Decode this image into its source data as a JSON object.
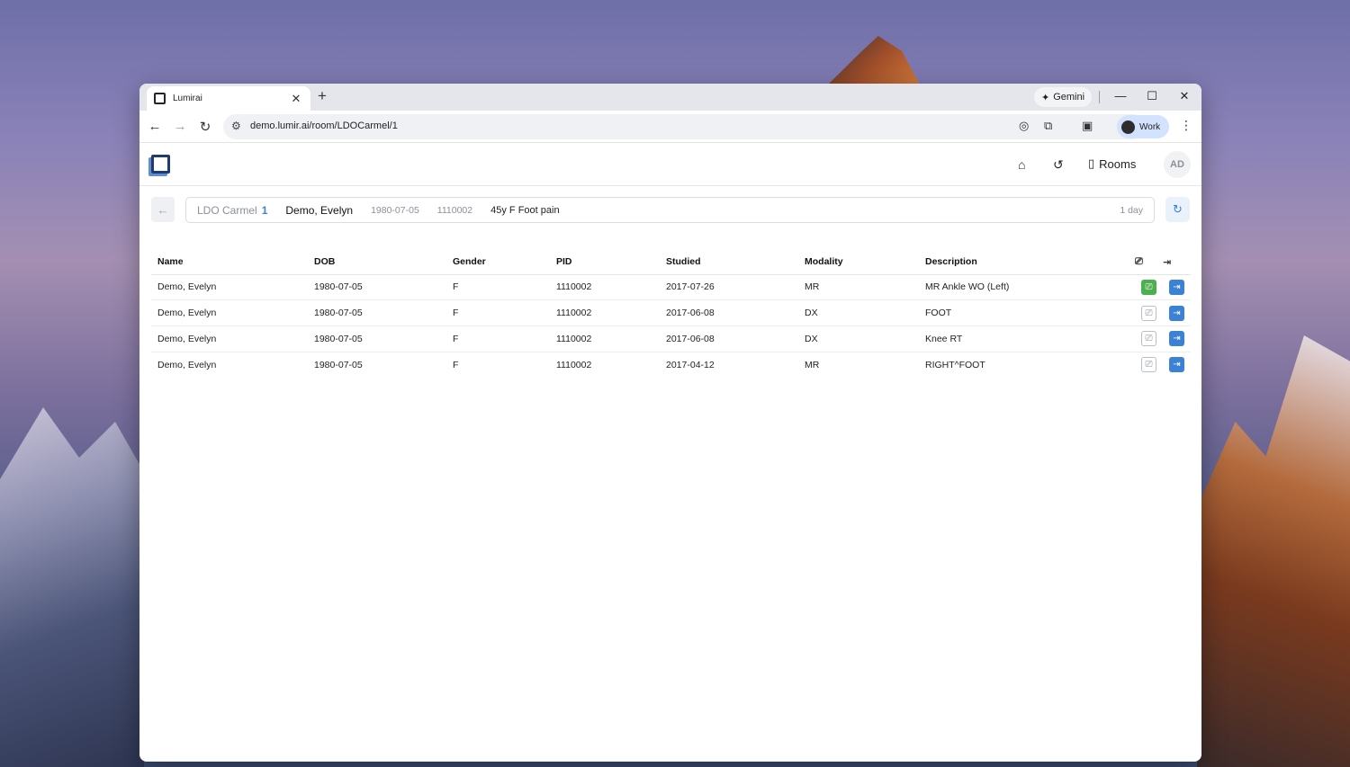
{
  "browser": {
    "tab_title": "Lumirai",
    "new_tab": "+",
    "gemini_label": "Gemini",
    "url": "demo.lumir.ai/room/LDOCarmel/1",
    "profile_label": "Work"
  },
  "app": {
    "nav": {
      "home_icon": "home-icon",
      "history_icon": "history-icon",
      "rooms_label": "Rooms",
      "avatar_initials": "AD"
    },
    "context": {
      "room_name": "LDO Carmel",
      "room_number": "1",
      "patient_name": "Demo, Evelyn",
      "dob": "1980-07-05",
      "pid": "1110002",
      "description": "45y F Foot pain",
      "age": "1 day"
    },
    "table": {
      "headers": [
        "Name",
        "DOB",
        "Gender",
        "PID",
        "Studied",
        "Modality",
        "Description"
      ],
      "rows": [
        {
          "name": "Demo, Evelyn",
          "dob": "1980-07-05",
          "gender": "F",
          "pid": "1110002",
          "studied": "2017-07-26",
          "modality": "MR",
          "description": "MR Ankle WO (Left)",
          "viewed": true
        },
        {
          "name": "Demo, Evelyn",
          "dob": "1980-07-05",
          "gender": "F",
          "pid": "1110002",
          "studied": "2017-06-08",
          "modality": "DX",
          "description": "FOOT",
          "viewed": false
        },
        {
          "name": "Demo, Evelyn",
          "dob": "1980-07-05",
          "gender": "F",
          "pid": "1110002",
          "studied": "2017-06-08",
          "modality": "DX",
          "description": "Knee RT",
          "viewed": false
        },
        {
          "name": "Demo, Evelyn",
          "dob": "1980-07-05",
          "gender": "F",
          "pid": "1110002",
          "studied": "2017-04-12",
          "modality": "MR",
          "description": "RIGHT^FOOT",
          "viewed": false
        }
      ]
    },
    "colors": {
      "accent": "#3c82d4",
      "viewed": "#4caf50"
    }
  }
}
